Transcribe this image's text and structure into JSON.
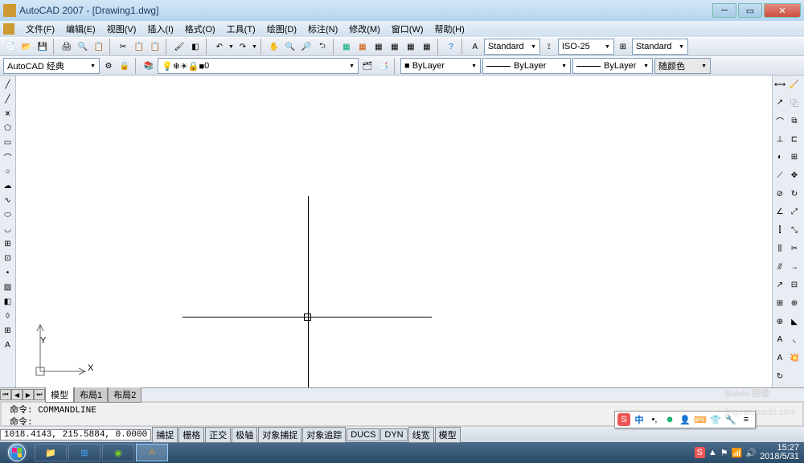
{
  "title": "AutoCAD 2007 - [Drawing1.dwg]",
  "menu": [
    "文件(F)",
    "编辑(E)",
    "视图(V)",
    "插入(I)",
    "格式(O)",
    "工具(T)",
    "绘图(D)",
    "标注(N)",
    "修改(M)",
    "窗口(W)",
    "帮助(H)"
  ],
  "style_combo": "Standard",
  "dim_combo": "ISO-25",
  "table_combo": "Standard",
  "workspace": "AutoCAD 经典",
  "layer": "0",
  "color": "■ ByLayer",
  "linetype": "ByLayer",
  "lineweight": "ByLayer",
  "plotstyle": "随颜色",
  "tabs": {
    "model": "模型",
    "layout1": "布局1",
    "layout2": "布局2"
  },
  "cmd1": "命令: COMMANDLINE",
  "cmd2": "命令:",
  "coords": "1018.4143, 215.5884, 0.0000",
  "statusbtns": [
    "捕捉",
    "栅格",
    "正交",
    "极轴",
    "对象捕捉",
    "对象追踪",
    "DUCS",
    "DYN",
    "线宽",
    "模型"
  ],
  "ime": {
    "brand": "S",
    "ch": "中"
  },
  "clock": {
    "time": "15:27",
    "date": "2018/5/31"
  },
  "ucs": {
    "x": "X",
    "y": "Y"
  },
  "watermark": "Baidu 经验",
  "watermark_url": "jingyan.baidu.com"
}
